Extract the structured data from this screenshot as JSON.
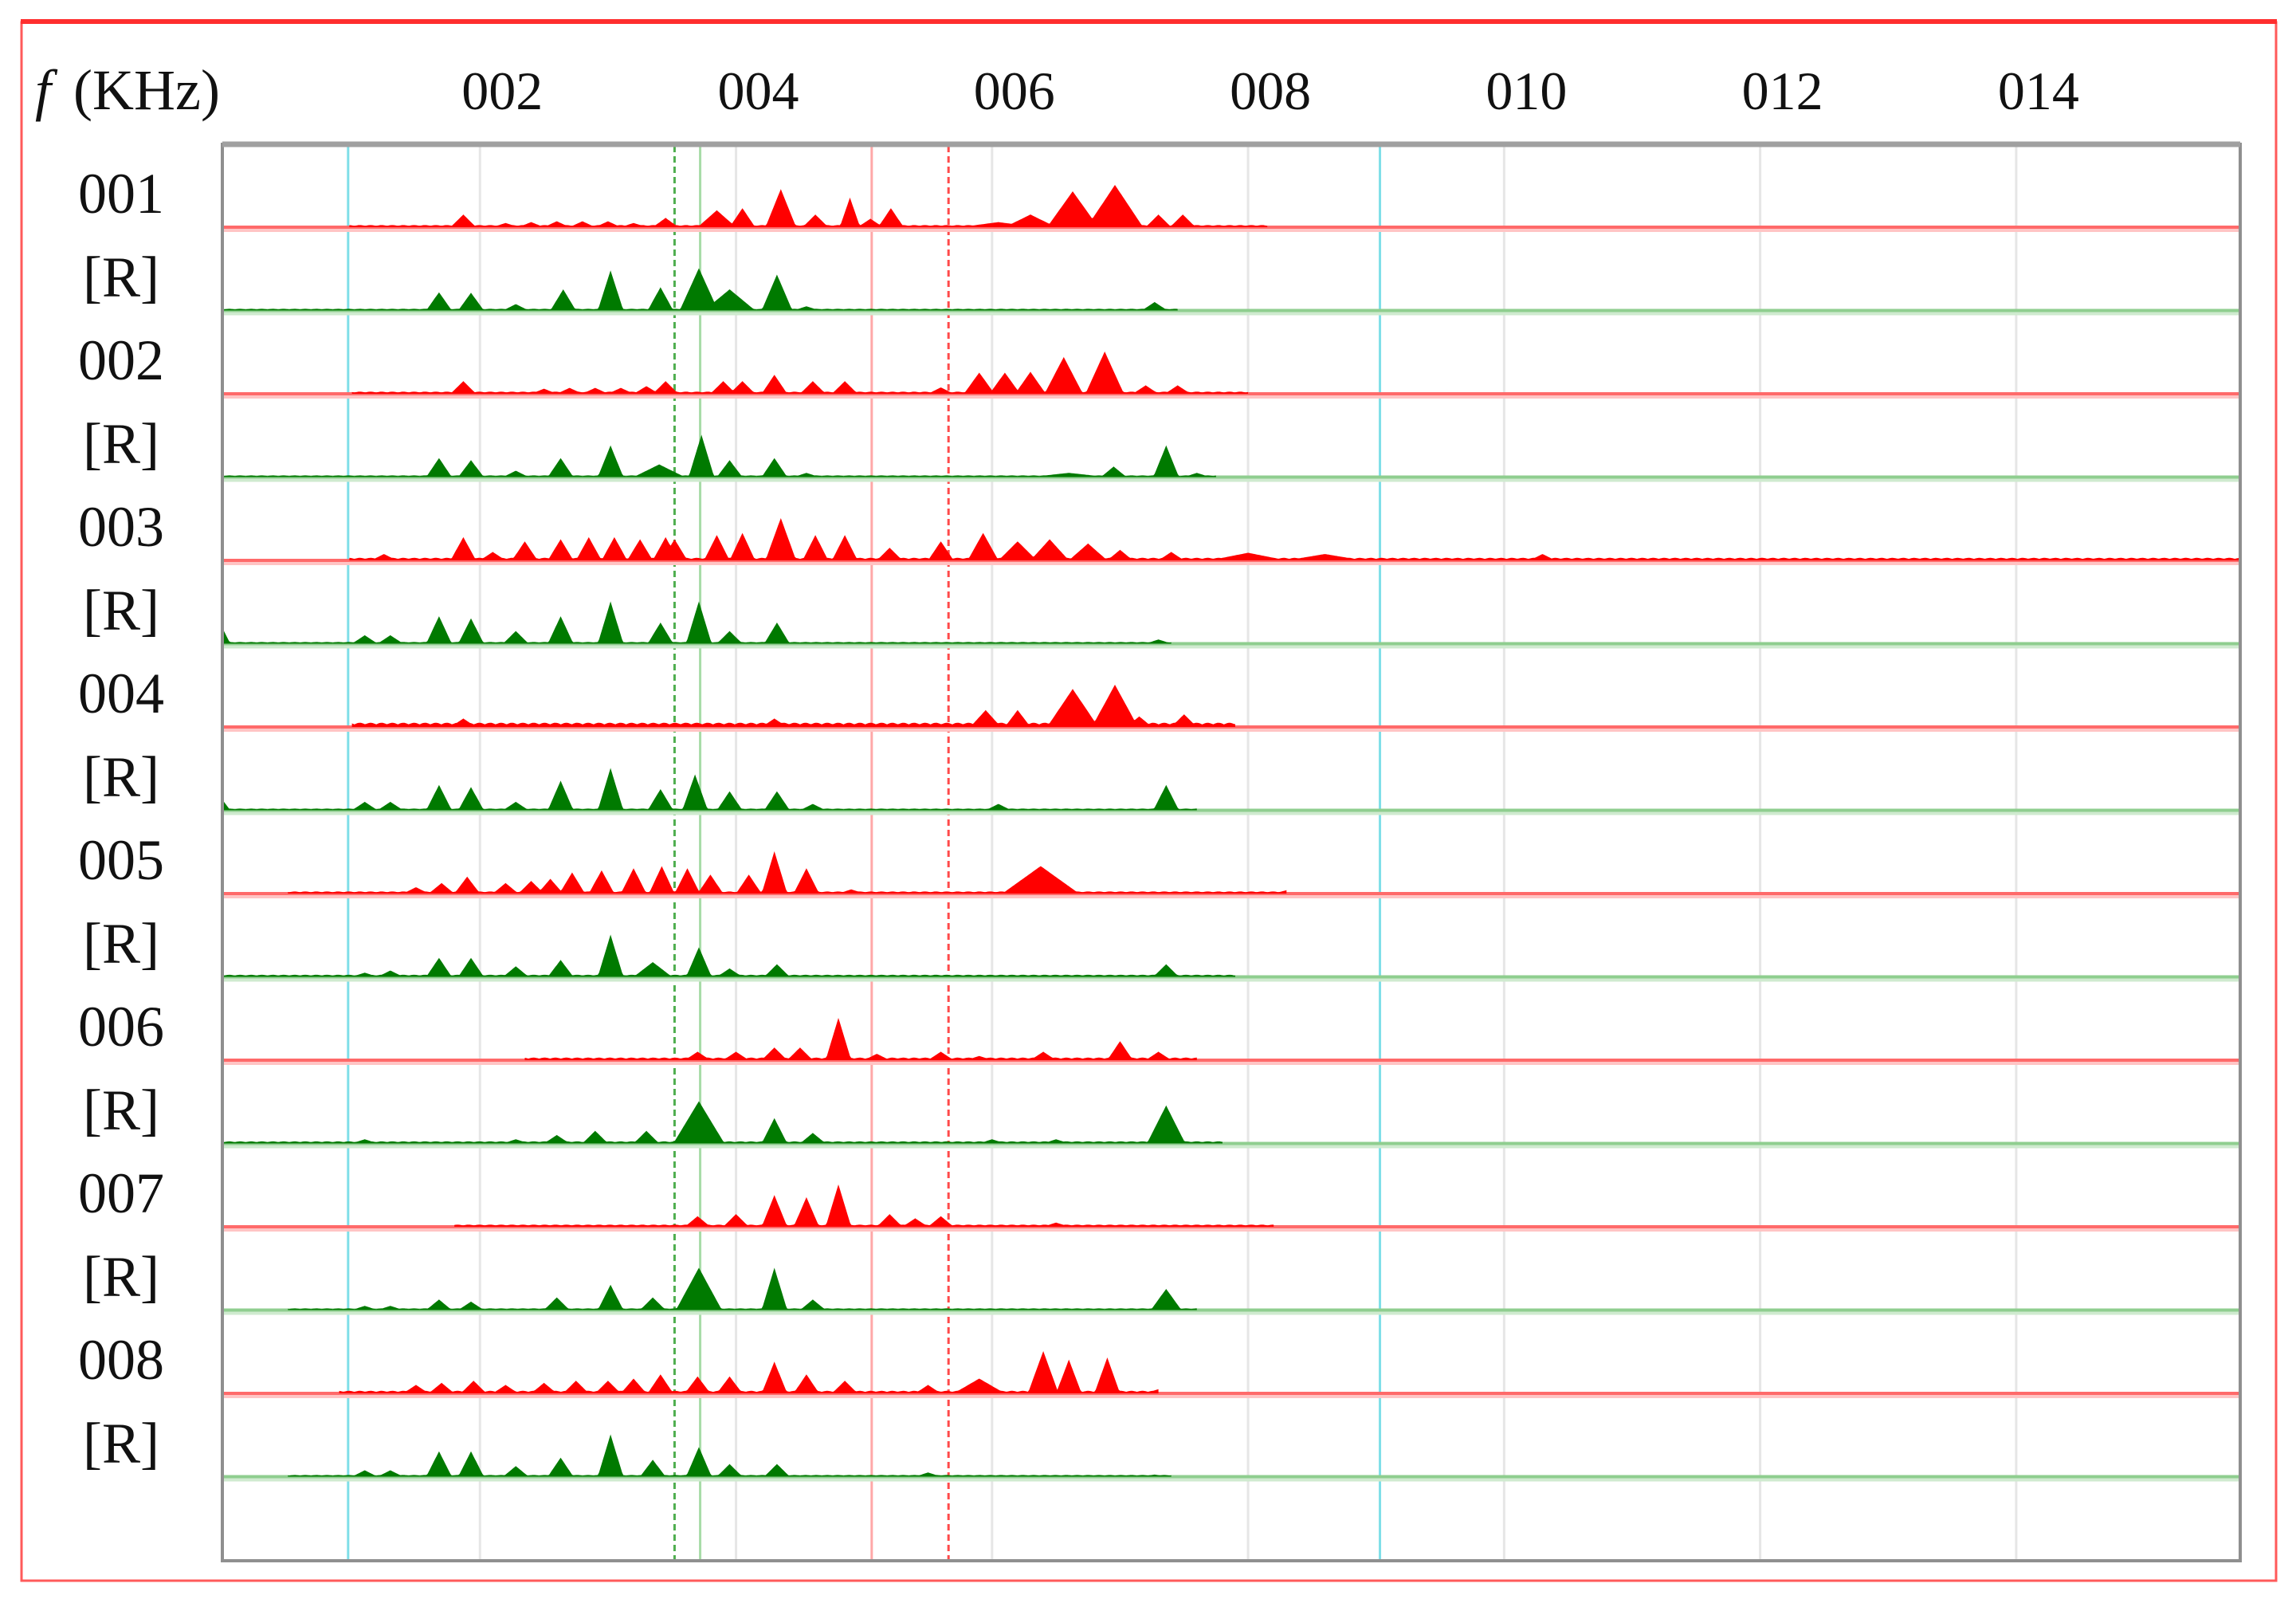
{
  "chart_data": {
    "type": "area",
    "title": "",
    "xlabel_symbol": "f",
    "xlabel_unit": "(KHz)",
    "x_tick_labels": [
      {
        "value": 2,
        "label": "002"
      },
      {
        "value": 4,
        "label": "004"
      },
      {
        "value": 6,
        "label": "006"
      },
      {
        "value": 8,
        "label": "008"
      },
      {
        "value": 10,
        "label": "010"
      },
      {
        "value": 12,
        "label": "012"
      },
      {
        "value": 14,
        "label": "014"
      }
    ],
    "xlim": [
      0,
      15.75
    ],
    "grid": true,
    "amplitude_units": "relative (1 = largest peak in row)",
    "markers": [
      {
        "f": 0.97,
        "color": "#7fdfe8",
        "style": "solid"
      },
      {
        "f": 3.52,
        "color": "#4fae4f",
        "style": "dashed"
      },
      {
        "f": 3.72,
        "color": "#a8dca8",
        "style": "solid"
      },
      {
        "f": 5.06,
        "color": "#ffa8a8",
        "style": "solid"
      },
      {
        "f": 5.66,
        "color": "#ff4a4a",
        "style": "dashed"
      },
      {
        "f": 9.03,
        "color": "#7fdfe8",
        "style": "solid"
      }
    ],
    "colors": {
      "signal": "#ff0000",
      "signal_line": "#ff6a6a",
      "signal_pale": "#ffc4c4",
      "reference": "#007a00",
      "reference_line": "#8fce8f",
      "reference_pale": "#cfeacf"
    },
    "rows": [
      {
        "label": "001",
        "kind": "signal",
        "range": [
          0.98,
          8.15
        ],
        "floor": 0.05,
        "peaks": [
          [
            1.87,
            0.3
          ],
          [
            2.2,
            0.1
          ],
          [
            2.4,
            0.12
          ],
          [
            2.6,
            0.14
          ],
          [
            2.8,
            0.14
          ],
          [
            3.0,
            0.14
          ],
          [
            3.2,
            0.1
          ],
          [
            3.45,
            0.22
          ],
          [
            3.85,
            0.4,
            0.15
          ],
          [
            4.05,
            0.45
          ],
          [
            4.35,
            0.9,
            0.12
          ],
          [
            4.62,
            0.3
          ],
          [
            4.89,
            0.7,
            0.08
          ],
          [
            5.05,
            0.2
          ],
          [
            5.21,
            0.45
          ],
          [
            6.05,
            0.12,
            0.3
          ],
          [
            6.3,
            0.3,
            0.2
          ],
          [
            6.63,
            0.85,
            0.2
          ],
          [
            6.96,
            1.0,
            0.22
          ],
          [
            7.3,
            0.3
          ],
          [
            7.49,
            0.3
          ]
        ]
      },
      {
        "label": "[R]",
        "kind": "reference",
        "range": [
          0.0,
          7.45
        ],
        "floor": 0.04,
        "peaks": [
          [
            1.68,
            0.43
          ],
          [
            1.93,
            0.42
          ],
          [
            2.28,
            0.15
          ],
          [
            2.65,
            0.5
          ],
          [
            3.02,
            0.95
          ],
          [
            3.41,
            0.55
          ],
          [
            3.71,
            1.0,
            0.15
          ],
          [
            3.95,
            0.5,
            0.2
          ],
          [
            4.32,
            0.85,
            0.12
          ],
          [
            4.55,
            0.1
          ],
          [
            7.27,
            0.2,
            0.1
          ]
        ]
      },
      {
        "label": "002",
        "kind": "signal",
        "range": [
          1.0,
          8.0
        ],
        "floor": 0.05,
        "peaks": [
          [
            1.87,
            0.3
          ],
          [
            2.5,
            0.12
          ],
          [
            2.7,
            0.14
          ],
          [
            2.9,
            0.14
          ],
          [
            3.1,
            0.14
          ],
          [
            3.3,
            0.18
          ],
          [
            3.45,
            0.3
          ],
          [
            3.9,
            0.3
          ],
          [
            4.05,
            0.3
          ],
          [
            4.3,
            0.45
          ],
          [
            4.6,
            0.3
          ],
          [
            4.85,
            0.3
          ],
          [
            5.6,
            0.15
          ],
          [
            5.9,
            0.5,
            0.12
          ],
          [
            6.1,
            0.5,
            0.12
          ],
          [
            6.3,
            0.52,
            0.12
          ],
          [
            6.56,
            0.87,
            0.15
          ],
          [
            6.88,
            1.0,
            0.15
          ],
          [
            7.2,
            0.2
          ],
          [
            7.45,
            0.2
          ],
          [
            9.55,
            0.1,
            0.15
          ]
        ]
      },
      {
        "label": "[R]",
        "kind": "reference",
        "range": [
          0.0,
          7.75
        ],
        "floor": 0.04,
        "peaks": [
          [
            1.68,
            0.45
          ],
          [
            1.93,
            0.4
          ],
          [
            2.28,
            0.15
          ],
          [
            2.63,
            0.45
          ],
          [
            3.02,
            0.75
          ],
          [
            3.4,
            0.3,
            0.2
          ],
          [
            3.73,
            1.0
          ],
          [
            3.95,
            0.4
          ],
          [
            4.3,
            0.45
          ],
          [
            4.55,
            0.1
          ],
          [
            6.6,
            0.1,
            0.3
          ],
          [
            6.95,
            0.25
          ],
          [
            7.36,
            0.75
          ],
          [
            7.6,
            0.1
          ]
        ]
      },
      {
        "label": "003",
        "kind": "signal",
        "range": [
          0.98,
          15.75
        ],
        "floor": 0.06,
        "peaks": [
          [
            1.25,
            0.15
          ],
          [
            1.87,
            0.55
          ],
          [
            2.1,
            0.2
          ],
          [
            2.35,
            0.45
          ],
          [
            2.63,
            0.5
          ],
          [
            2.85,
            0.55
          ],
          [
            3.05,
            0.55
          ],
          [
            3.25,
            0.5
          ],
          [
            3.45,
            0.55
          ],
          [
            3.52,
            0.5
          ],
          [
            3.85,
            0.6
          ],
          [
            4.05,
            0.65
          ],
          [
            4.35,
            1.0,
            0.12
          ],
          [
            4.62,
            0.6
          ],
          [
            4.85,
            0.6
          ],
          [
            5.2,
            0.3
          ],
          [
            5.6,
            0.45
          ],
          [
            5.93,
            0.65,
            0.12
          ],
          [
            6.2,
            0.45,
            0.15
          ],
          [
            6.45,
            0.5,
            0.15
          ],
          [
            6.75,
            0.4,
            0.15
          ],
          [
            7.0,
            0.25
          ],
          [
            7.4,
            0.2
          ],
          [
            8.0,
            0.18,
            0.3
          ],
          [
            8.6,
            0.15,
            0.3
          ],
          [
            10.3,
            0.15
          ]
        ]
      },
      {
        "label": "[R]",
        "kind": "reference",
        "range": [
          0.0,
          7.4
        ],
        "floor": 0.04,
        "peaks": [
          [
            0.0,
            0.3,
            0.05
          ],
          [
            1.1,
            0.2
          ],
          [
            1.3,
            0.2
          ],
          [
            1.68,
            0.65
          ],
          [
            1.93,
            0.6
          ],
          [
            2.28,
            0.3
          ],
          [
            2.63,
            0.65
          ],
          [
            3.02,
            1.0
          ],
          [
            3.41,
            0.5
          ],
          [
            3.71,
            1.0
          ],
          [
            3.95,
            0.3
          ],
          [
            4.32,
            0.5
          ],
          [
            7.3,
            0.1
          ]
        ]
      },
      {
        "label": "004",
        "kind": "signal",
        "range": [
          1.0,
          7.9
        ],
        "floor": 0.1,
        "peaks": [
          [
            1.87,
            0.2
          ],
          [
            4.3,
            0.2
          ],
          [
            5.95,
            0.4,
            0.12
          ],
          [
            6.2,
            0.4
          ],
          [
            6.63,
            0.9,
            0.2
          ],
          [
            6.96,
            1.0,
            0.18
          ],
          [
            7.15,
            0.25
          ],
          [
            7.5,
            0.3
          ]
        ]
      },
      {
        "label": "[R]",
        "kind": "reference",
        "range": [
          0.0,
          7.6
        ],
        "floor": 0.04,
        "peaks": [
          [
            0.0,
            0.2,
            0.05
          ],
          [
            1.1,
            0.2
          ],
          [
            1.3,
            0.2
          ],
          [
            1.68,
            0.6
          ],
          [
            1.93,
            0.55
          ],
          [
            2.28,
            0.2
          ],
          [
            2.63,
            0.7
          ],
          [
            3.02,
            1.0
          ],
          [
            3.41,
            0.5
          ],
          [
            3.68,
            0.85
          ],
          [
            3.95,
            0.45
          ],
          [
            4.32,
            0.45
          ],
          [
            4.6,
            0.15
          ],
          [
            6.05,
            0.15
          ],
          [
            7.36,
            0.6
          ]
        ]
      },
      {
        "label": "005",
        "kind": "signal",
        "range": [
          0.5,
          8.3
        ],
        "floor": 0.05,
        "peaks": [
          [
            1.5,
            0.15
          ],
          [
            1.7,
            0.25
          ],
          [
            1.9,
            0.4
          ],
          [
            2.2,
            0.25
          ],
          [
            2.4,
            0.3
          ],
          [
            2.55,
            0.35
          ],
          [
            2.72,
            0.5
          ],
          [
            2.95,
            0.55
          ],
          [
            3.2,
            0.6
          ],
          [
            3.42,
            0.65
          ],
          [
            3.62,
            0.6
          ],
          [
            3.8,
            0.45
          ],
          [
            4.1,
            0.45
          ],
          [
            4.3,
            1.0
          ],
          [
            4.55,
            0.6
          ],
          [
            4.9,
            0.1
          ],
          [
            6.38,
            0.65,
            0.3
          ],
          [
            7.0,
            0.05
          ],
          [
            8.3,
            0.08
          ],
          [
            10.3,
            0.06,
            0.15
          ]
        ]
      },
      {
        "label": "[R]",
        "kind": "reference",
        "range": [
          0.0,
          7.9
        ],
        "floor": 0.05,
        "peaks": [
          [
            1.1,
            0.1
          ],
          [
            1.3,
            0.15
          ],
          [
            1.68,
            0.45
          ],
          [
            1.93,
            0.45
          ],
          [
            2.28,
            0.25
          ],
          [
            2.63,
            0.4
          ],
          [
            3.02,
            1.0
          ],
          [
            3.35,
            0.35,
            0.15
          ],
          [
            3.71,
            0.7
          ],
          [
            3.95,
            0.2
          ],
          [
            4.32,
            0.3
          ],
          [
            7.36,
            0.3
          ]
        ]
      },
      {
        "label": "006",
        "kind": "signal",
        "range": [
          2.35,
          7.6
        ],
        "floor": 0.06,
        "peaks": [
          [
            3.7,
            0.2
          ],
          [
            4.0,
            0.2
          ],
          [
            4.3,
            0.3
          ],
          [
            4.5,
            0.3
          ],
          [
            4.8,
            1.0,
            0.1
          ],
          [
            5.1,
            0.15
          ],
          [
            5.6,
            0.2
          ],
          [
            5.9,
            0.1
          ],
          [
            6.4,
            0.2
          ],
          [
            7.0,
            0.45
          ],
          [
            7.3,
            0.2
          ]
        ]
      },
      {
        "label": "[R]",
        "kind": "reference",
        "range": [
          0.0,
          7.8
        ],
        "floor": 0.05,
        "peaks": [
          [
            1.1,
            0.1
          ],
          [
            2.28,
            0.1
          ],
          [
            2.6,
            0.2
          ],
          [
            2.9,
            0.3
          ],
          [
            3.3,
            0.3
          ],
          [
            3.71,
            1.0,
            0.2
          ],
          [
            4.3,
            0.6
          ],
          [
            4.6,
            0.25
          ],
          [
            6.0,
            0.1
          ],
          [
            6.5,
            0.1
          ],
          [
            7.36,
            0.9,
            0.15
          ]
        ]
      },
      {
        "label": "007",
        "kind": "signal",
        "range": [
          1.8,
          8.2
        ],
        "floor": 0.05,
        "peaks": [
          [
            3.7,
            0.25
          ],
          [
            4.0,
            0.3
          ],
          [
            4.3,
            0.75
          ],
          [
            4.55,
            0.7
          ],
          [
            4.8,
            1.0,
            0.1
          ],
          [
            5.2,
            0.3
          ],
          [
            5.4,
            0.2
          ],
          [
            5.6,
            0.25
          ],
          [
            6.5,
            0.1
          ]
        ]
      },
      {
        "label": "[R]",
        "kind": "reference",
        "range": [
          0.5,
          7.6
        ],
        "floor": 0.04,
        "peaks": [
          [
            1.1,
            0.1
          ],
          [
            1.3,
            0.1
          ],
          [
            1.68,
            0.25
          ],
          [
            1.93,
            0.2
          ],
          [
            2.6,
            0.3
          ],
          [
            3.02,
            0.6
          ],
          [
            3.35,
            0.3
          ],
          [
            3.71,
            1.0,
            0.18
          ],
          [
            4.3,
            1.0
          ],
          [
            4.6,
            0.25
          ],
          [
            7.36,
            0.5,
            0.12
          ]
        ]
      },
      {
        "label": "008",
        "kind": "signal",
        "range": [
          0.9,
          7.3
        ],
        "floor": 0.06,
        "peaks": [
          [
            1.5,
            0.2
          ],
          [
            1.7,
            0.25
          ],
          [
            1.95,
            0.3
          ],
          [
            2.2,
            0.2
          ],
          [
            2.5,
            0.25
          ],
          [
            2.75,
            0.3
          ],
          [
            3.0,
            0.3
          ],
          [
            3.2,
            0.35
          ],
          [
            3.41,
            0.45
          ],
          [
            3.7,
            0.4
          ],
          [
            3.95,
            0.4
          ],
          [
            4.3,
            0.75
          ],
          [
            4.55,
            0.45
          ],
          [
            4.85,
            0.3
          ],
          [
            5.5,
            0.2
          ],
          [
            5.9,
            0.35,
            0.2
          ],
          [
            6.4,
            1.0,
            0.12
          ],
          [
            6.6,
            0.8
          ],
          [
            6.9,
            0.85
          ],
          [
            7.3,
            0.1
          ]
        ]
      },
      {
        "label": "[R]",
        "kind": "reference",
        "range": [
          0.5,
          7.4
        ],
        "floor": 0.04,
        "peaks": [
          [
            1.1,
            0.15
          ],
          [
            1.3,
            0.15
          ],
          [
            1.68,
            0.6
          ],
          [
            1.93,
            0.6
          ],
          [
            2.28,
            0.25
          ],
          [
            2.63,
            0.45
          ],
          [
            3.02,
            1.0
          ],
          [
            3.35,
            0.4
          ],
          [
            3.71,
            0.7
          ],
          [
            3.95,
            0.3
          ],
          [
            4.32,
            0.3
          ],
          [
            5.5,
            0.1
          ],
          [
            7.27,
            0.05
          ]
        ]
      }
    ]
  }
}
